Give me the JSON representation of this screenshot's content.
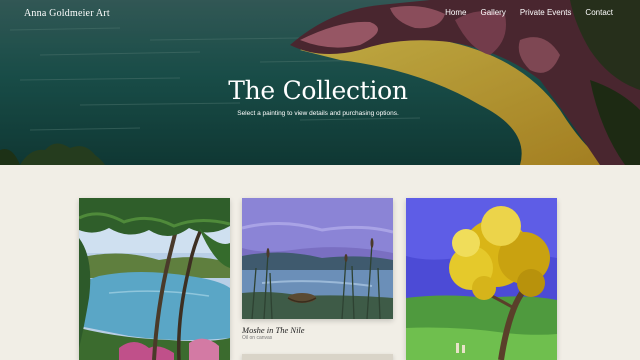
{
  "site": {
    "brand": "Anna Goldmeier Art"
  },
  "nav": {
    "items": [
      "Home",
      "Gallery",
      "Private Events",
      "Contact"
    ]
  },
  "hero": {
    "title": "The Collection",
    "subtitle": "Select a painting to view details and purchasing options."
  },
  "gallery": {
    "items": [
      {
        "title": "",
        "medium": ""
      },
      {
        "title": "Moshe in The Nile",
        "medium": "Oil on canvas"
      },
      {
        "title": "",
        "medium": ""
      }
    ]
  },
  "colors": {
    "background": "#f1eee6",
    "text_light": "#ffffff",
    "text_dark": "#222222"
  }
}
